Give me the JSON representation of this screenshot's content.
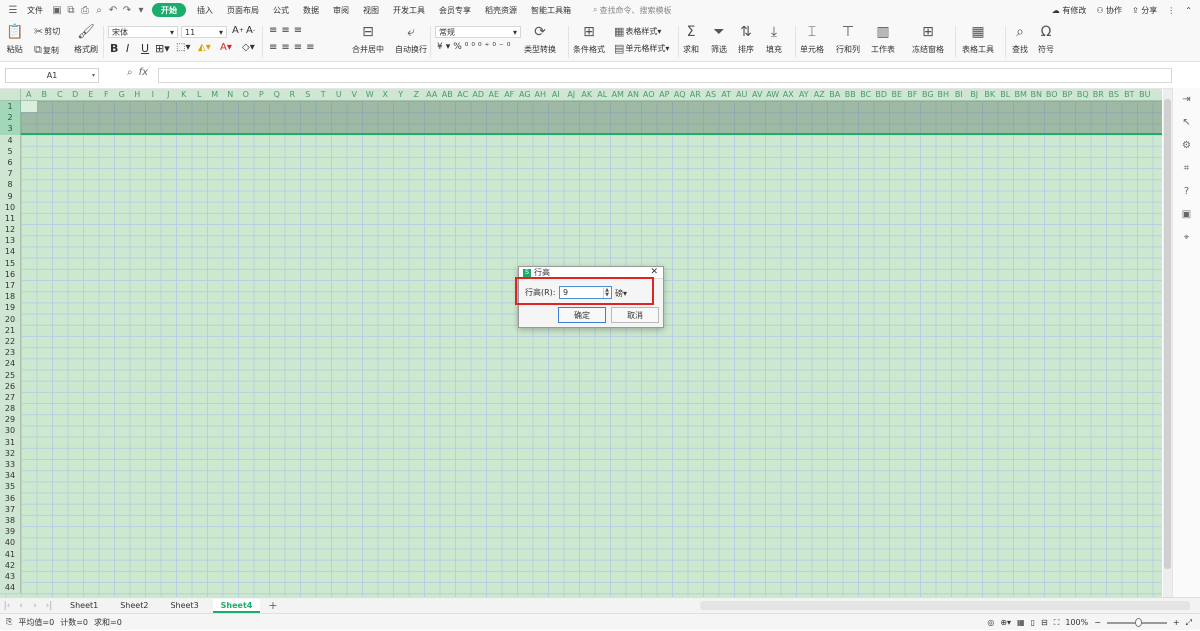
{
  "menubar": {
    "file": "文件",
    "tabs": [
      "开始",
      "插入",
      "页面布局",
      "公式",
      "数据",
      "审阅",
      "视图",
      "开发工具",
      "会员专享",
      "稻壳资源",
      "智能工具箱"
    ],
    "active_tab": "开始",
    "search_placeholder": "查找命令、搜索模板",
    "modified": "有修改",
    "collab": "协作",
    "share": "分享"
  },
  "ribbon": {
    "paste": "粘贴",
    "cut": "剪切",
    "copy": "复制",
    "format_painter": "格式刷",
    "font_name": "宋体",
    "font_size": "11",
    "merge_center": "合并居中",
    "wrap_text": "自动换行",
    "number_format": "常规",
    "type_convert": "类型转换",
    "cond_format": "条件格式",
    "table_style": "表格样式",
    "cell_style": "单元格样式",
    "sum": "求和",
    "filter": "筛选",
    "sort": "排序",
    "fill": "填充",
    "cell": "单元格",
    "row_col": "行和列",
    "worksheet": "工作表",
    "freeze": "冻结窗格",
    "table_tools": "表格工具",
    "find": "查找",
    "symbol": "符号"
  },
  "formula_bar": {
    "name_box": "A1",
    "fx": "fx"
  },
  "columns": [
    "A",
    "B",
    "C",
    "D",
    "E",
    "F",
    "G",
    "H",
    "I",
    "J",
    "K",
    "L",
    "M",
    "N",
    "O",
    "P",
    "Q",
    "R",
    "S",
    "T",
    "U",
    "V",
    "W",
    "X",
    "Y",
    "Z",
    "AA",
    "AB",
    "AC",
    "AD",
    "AE",
    "AF",
    "AG",
    "AH",
    "AI",
    "AJ",
    "AK",
    "AL",
    "AM",
    "AN",
    "AO",
    "AP",
    "AQ",
    "AR",
    "AS",
    "AT",
    "AU",
    "AV",
    "AW",
    "AX",
    "AY",
    "AZ",
    "BA",
    "BB",
    "BC",
    "BD",
    "BE",
    "BF",
    "BG",
    "BH",
    "BI",
    "BJ",
    "BK",
    "BL",
    "BM",
    "BN",
    "BO",
    "BP",
    "BQ",
    "BR",
    "BS",
    "BT",
    "BU"
  ],
  "row_count": 44,
  "dialog": {
    "title": "行高",
    "label": "行高(R):",
    "value": "9",
    "unit": "磅",
    "ok": "确定",
    "cancel": "取消"
  },
  "sheets": [
    "Sheet1",
    "Sheet2",
    "Sheet3",
    "Sheet4"
  ],
  "active_sheet": "Sheet4",
  "status": {
    "average": "平均值=0",
    "count": "计数=0",
    "sum": "求和=0",
    "zoom": "100%"
  },
  "colors": {
    "accent": "#1aad6b",
    "grid_bg": "#cce8cf",
    "highlight": "#e02424"
  }
}
